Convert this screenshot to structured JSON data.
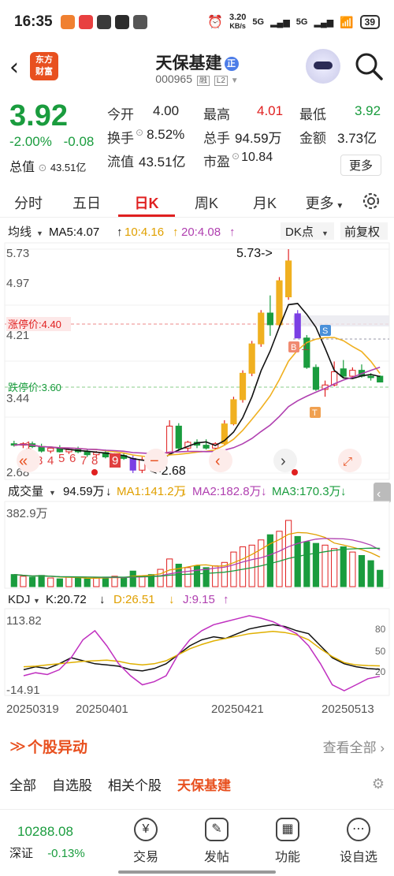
{
  "status_bar": {
    "time": "16:35",
    "net_speed": "3.20",
    "net_unit": "KB/s",
    "signal1": "5G",
    "signal2": "5G",
    "battery": "39"
  },
  "header": {
    "logo_text": "东方财富",
    "stock_name": "天保基建",
    "badge": "正",
    "code": "000965",
    "code_tag1": "融",
    "code_tag2": "L2"
  },
  "quote": {
    "price": "3.92",
    "change_pct": "-2.00%",
    "change_abs": "-0.08",
    "total_value_label": "总值",
    "total_value": "43.51亿",
    "rows": [
      [
        {
          "label": "今开",
          "value": "4.00",
          "color": "#222222"
        },
        {
          "label": "最高",
          "value": "4.01",
          "color": "#e02020"
        },
        {
          "label": "最低",
          "value": "3.92",
          "color": "#1a9c3e"
        }
      ],
      [
        {
          "label": "换手",
          "value": "8.52%",
          "color": "#222222"
        },
        {
          "label": "总手",
          "value": "94.59万",
          "color": "#222222"
        },
        {
          "label": "金额",
          "value": "3.73亿",
          "color": "#222222"
        }
      ],
      [
        {
          "label": "流值",
          "value": "43.51亿",
          "color": "#222222"
        },
        {
          "label": "市盈",
          "value": "10.84",
          "color": "#222222"
        }
      ]
    ],
    "more_label": "更多"
  },
  "tabs": [
    "分时",
    "五日",
    "日K",
    "周K",
    "月K",
    "更多"
  ],
  "active_tab": "日K",
  "kline": {
    "ma_label": "均线",
    "ma5": "MA5:4.07",
    "ma10": "10:4.16",
    "ma20": "20:4.08",
    "dk_label": "DK点",
    "adjust_label": "前复权",
    "y_ticks": [
      "5.73",
      "4.97",
      "4.21",
      "3.44",
      "2.68"
    ],
    "limit_up": "涨停价:4.40",
    "limit_down": "跌停价:3.60",
    "high_label": "5.73->",
    "low_label": "<-2.68",
    "pager": [
      "1",
      "2",
      "3",
      "4",
      "5",
      "6",
      "7",
      "8",
      "9"
    ]
  },
  "volume": {
    "label": "成交量",
    "value": "94.59万",
    "ma1": "MA1:141.2万",
    "ma2": "MA2:182.8万",
    "ma3": "MA3:170.3万",
    "max_label": "382.9万"
  },
  "kdj": {
    "label": "KDJ",
    "k": "K:20.72",
    "d": "D:26.51",
    "j": "J:9.15",
    "y_top": "113.82",
    "y_bottom": "-14.91",
    "ref_ticks": [
      "80",
      "50",
      "20"
    ]
  },
  "x_dates": [
    "20250319",
    "20250401",
    "20250421",
    "20250513"
  ],
  "chart_data": {
    "type": "candlestick",
    "title": "",
    "ylim": [
      2.68,
      5.73
    ],
    "candles": [
      {
        "o": 3.08,
        "h": 3.12,
        "l": 3.04,
        "c": 3.06
      },
      {
        "o": 3.06,
        "h": 3.1,
        "l": 3.02,
        "c": 3.08
      },
      {
        "o": 3.08,
        "h": 3.11,
        "l": 3.02,
        "c": 3.04
      },
      {
        "o": 3.04,
        "h": 3.08,
        "l": 2.96,
        "c": 2.98
      },
      {
        "o": 2.98,
        "h": 3.04,
        "l": 2.95,
        "c": 3.02
      },
      {
        "o": 3.02,
        "h": 3.06,
        "l": 2.96,
        "c": 2.97
      },
      {
        "o": 2.97,
        "h": 3.02,
        "l": 2.94,
        "c": 3.0
      },
      {
        "o": 3.0,
        "h": 3.04,
        "l": 2.95,
        "c": 2.97
      },
      {
        "o": 2.97,
        "h": 3.0,
        "l": 2.9,
        "c": 2.93
      },
      {
        "o": 2.93,
        "h": 2.98,
        "l": 2.9,
        "c": 2.96
      },
      {
        "o": 2.96,
        "h": 3.0,
        "l": 2.88,
        "c": 2.9
      },
      {
        "o": 2.9,
        "h": 2.95,
        "l": 2.86,
        "c": 2.92
      },
      {
        "o": 2.92,
        "h": 2.96,
        "l": 2.86,
        "c": 2.88
      },
      {
        "o": 2.88,
        "h": 2.92,
        "l": 2.68,
        "c": 2.72
      },
      {
        "o": 2.72,
        "h": 2.9,
        "l": 2.68,
        "c": 2.86
      },
      {
        "o": 2.86,
        "h": 2.92,
        "l": 2.8,
        "c": 2.83
      },
      {
        "o": 2.83,
        "h": 2.98,
        "l": 2.8,
        "c": 2.95
      },
      {
        "o": 2.95,
        "h": 3.4,
        "l": 2.93,
        "c": 3.32
      },
      {
        "o": 3.32,
        "h": 3.36,
        "l": 2.98,
        "c": 3.02
      },
      {
        "o": 3.02,
        "h": 3.12,
        "l": 2.98,
        "c": 3.1
      },
      {
        "o": 3.1,
        "h": 3.14,
        "l": 3.02,
        "c": 3.06
      },
      {
        "o": 3.06,
        "h": 3.14,
        "l": 3.0,
        "c": 3.02
      },
      {
        "o": 3.02,
        "h": 3.1,
        "l": 3.0,
        "c": 3.08
      },
      {
        "o": 3.08,
        "h": 3.4,
        "l": 3.06,
        "c": 3.35
      },
      {
        "o": 3.35,
        "h": 3.72,
        "l": 3.33,
        "c": 3.68
      },
      {
        "o": 3.68,
        "h": 4.08,
        "l": 3.64,
        "c": 4.04
      },
      {
        "o": 4.04,
        "h": 4.48,
        "l": 4.0,
        "c": 4.44
      },
      {
        "o": 4.44,
        "h": 4.9,
        "l": 4.4,
        "c": 4.86
      },
      {
        "o": 4.86,
        "h": 5.1,
        "l": 4.55,
        "c": 4.7
      },
      {
        "o": 4.7,
        "h": 5.35,
        "l": 4.66,
        "c": 5.3
      },
      {
        "o": 5.08,
        "h": 5.73,
        "l": 5.04,
        "c": 5.57
      },
      {
        "o": 4.85,
        "h": 4.9,
        "l": 4.52,
        "c": 4.52
      },
      {
        "o": 4.52,
        "h": 4.56,
        "l": 4.1,
        "c": 4.12
      },
      {
        "o": 4.12,
        "h": 4.16,
        "l": 3.8,
        "c": 3.82
      },
      {
        "o": 3.82,
        "h": 3.94,
        "l": 3.72,
        "c": 3.88
      },
      {
        "o": 3.88,
        "h": 4.2,
        "l": 3.86,
        "c": 4.06
      },
      {
        "o": 4.1,
        "h": 4.22,
        "l": 3.98,
        "c": 4.0
      },
      {
        "o": 4.0,
        "h": 4.12,
        "l": 3.96,
        "c": 4.08
      },
      {
        "o": 4.08,
        "h": 4.16,
        "l": 3.98,
        "c": 4.0
      },
      {
        "o": 4.0,
        "h": 4.04,
        "l": 3.94,
        "c": 3.98
      },
      {
        "o": 4.0,
        "h": 4.01,
        "l": 3.92,
        "c": 3.92
      }
    ],
    "volume": [
      70,
      60,
      55,
      65,
      50,
      45,
      55,
      50,
      45,
      50,
      55,
      60,
      50,
      90,
      60,
      70,
      100,
      160,
      130,
      110,
      120,
      110,
      120,
      140,
      200,
      230,
      240,
      270,
      300,
      320,
      382.9,
      290,
      260,
      250,
      240,
      220,
      230,
      200,
      180,
      150,
      94.59
    ],
    "kdj": {
      "k": [
        20,
        25,
        22,
        30,
        40,
        35,
        30,
        28,
        26,
        20,
        18,
        22,
        30,
        45,
        60,
        70,
        75,
        72,
        80,
        88,
        92,
        95,
        92,
        85,
        80,
        60,
        40,
        30,
        25,
        22,
        20.72
      ],
      "d": [
        25,
        26,
        28,
        30,
        32,
        34,
        35,
        36,
        34,
        30,
        28,
        30,
        35,
        45,
        55,
        62,
        68,
        72,
        76,
        80,
        82,
        84,
        82,
        78,
        70,
        55,
        42,
        32,
        28,
        27,
        26.51
      ],
      "j": [
        10,
        15,
        12,
        20,
        40,
        70,
        85,
        60,
        30,
        10,
        -5,
        0,
        10,
        45,
        70,
        85,
        95,
        100,
        105,
        110,
        106,
        100,
        90,
        80,
        60,
        30,
        -5,
        -14.91,
        -5,
        5,
        9.15
      ]
    }
  },
  "stock_activity": {
    "title": "个股异动",
    "more": "查看全部"
  },
  "subtabs": [
    "全部",
    "自选股",
    "相关个股",
    "天保基建"
  ],
  "active_subtab": "天保基建",
  "bottom_bar": {
    "index_value": "10288.08",
    "index_name": "深证",
    "index_change": "-0.13%",
    "items": [
      {
        "label": "交易",
        "icon": "¥"
      },
      {
        "label": "发帖",
        "icon": "✎"
      },
      {
        "label": "功能",
        "icon": "▦"
      },
      {
        "label": "设自选",
        "icon": "⋯"
      }
    ]
  },
  "colors": {
    "up": "#e02020",
    "down": "#1a9c3e",
    "ma5": "#111111",
    "ma10": "#f0b020",
    "ma20": "#b040b0",
    "accent": "#e8501f"
  }
}
